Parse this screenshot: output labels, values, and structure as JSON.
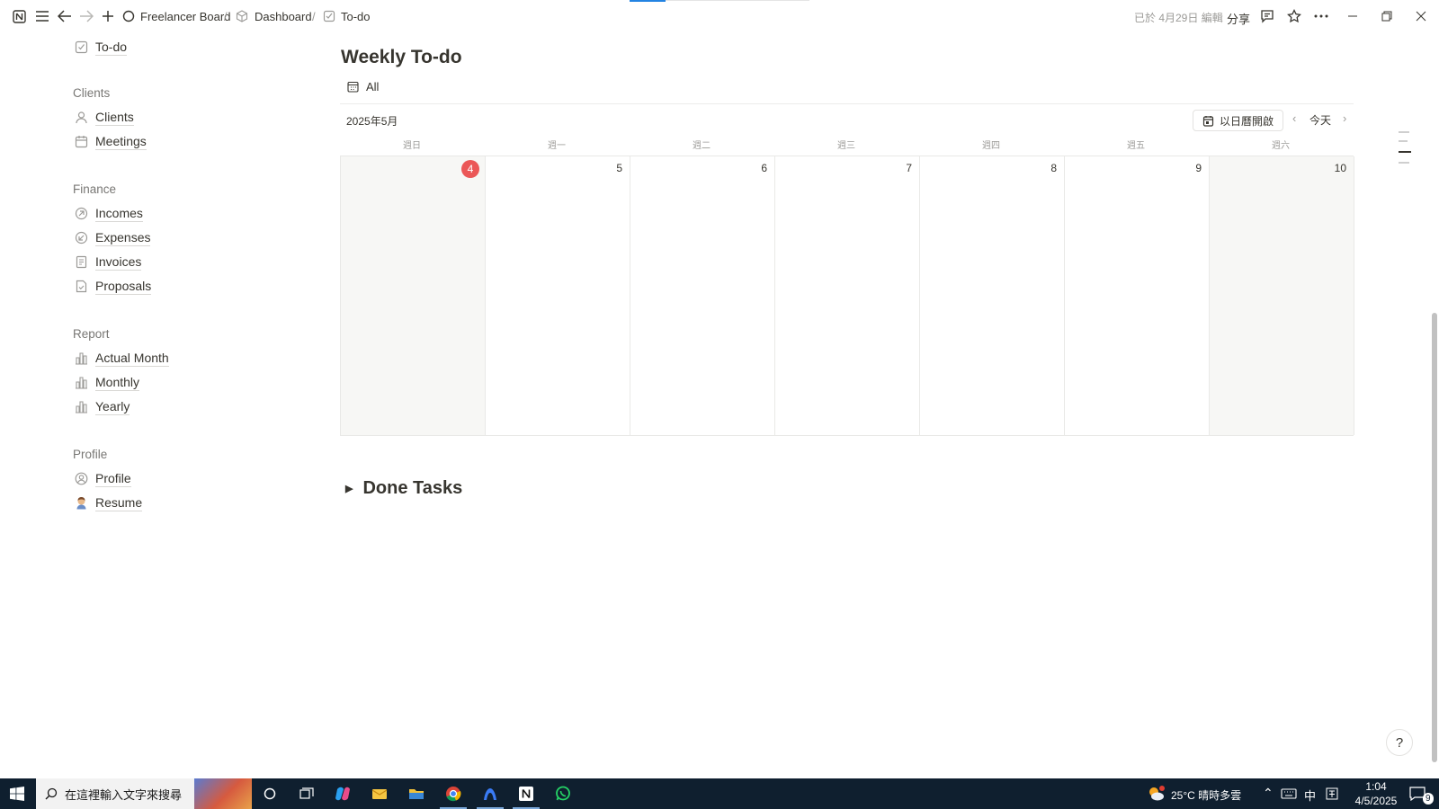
{
  "topbar": {
    "breadcrumb": [
      {
        "label": "Freelancer Board",
        "icon": "circle-icon"
      },
      {
        "label": "Dashboard",
        "icon": "cube-icon"
      },
      {
        "label": "To-do",
        "icon": "checkbox-icon"
      }
    ],
    "separator": "/",
    "edited": "已於 4月29日 編輯",
    "share": "分享"
  },
  "sidebar": {
    "top_item": {
      "label": "To-do",
      "icon": "checkbox-icon"
    },
    "sections": [
      {
        "heading": "Clients",
        "items": [
          {
            "label": "Clients",
            "icon": "person-icon"
          },
          {
            "label": "Meetings",
            "icon": "calendar-icon"
          }
        ]
      },
      {
        "heading": "Finance",
        "items": [
          {
            "label": "Incomes",
            "icon": "arrow-up-circle-icon"
          },
          {
            "label": "Expenses",
            "icon": "arrow-down-circle-icon"
          },
          {
            "label": "Invoices",
            "icon": "document-icon"
          },
          {
            "label": "Proposals",
            "icon": "document-check-icon"
          }
        ]
      },
      {
        "heading": "Report",
        "items": [
          {
            "label": "Actual Month",
            "icon": "bar-chart-icon"
          },
          {
            "label": "Monthly",
            "icon": "bar-chart-icon"
          },
          {
            "label": "Yearly",
            "icon": "bar-chart-icon"
          }
        ]
      },
      {
        "heading": "Profile",
        "items": [
          {
            "label": "Profile",
            "icon": "person-circle-icon"
          },
          {
            "label": "Resume",
            "icon": "avatar-emoji-icon"
          }
        ]
      }
    ]
  },
  "main": {
    "title": "Weekly To-do",
    "view_tab": "All",
    "calendar": {
      "month_label": "2025年5月",
      "open_in_calendar": "以日曆開啟",
      "today": "今天",
      "weekdays": [
        "週日",
        "週一",
        "週二",
        "週三",
        "週四",
        "週五",
        "週六"
      ],
      "days": [
        "4",
        "5",
        "6",
        "7",
        "8",
        "9",
        "10"
      ],
      "today_index": 0
    },
    "done_toggle": "Done Tasks"
  },
  "taskbar": {
    "search_placeholder": "在這裡輸入文字來搜尋",
    "weather": "25°C 晴時多雲",
    "ime": "中",
    "time": "1:04",
    "date": "4/5/2025",
    "notifications": "9"
  },
  "colors": {
    "today_badge": "#eb5757",
    "taskbar_bg": "#0f1f2f",
    "weekend_bg": "#f7f7f5"
  }
}
